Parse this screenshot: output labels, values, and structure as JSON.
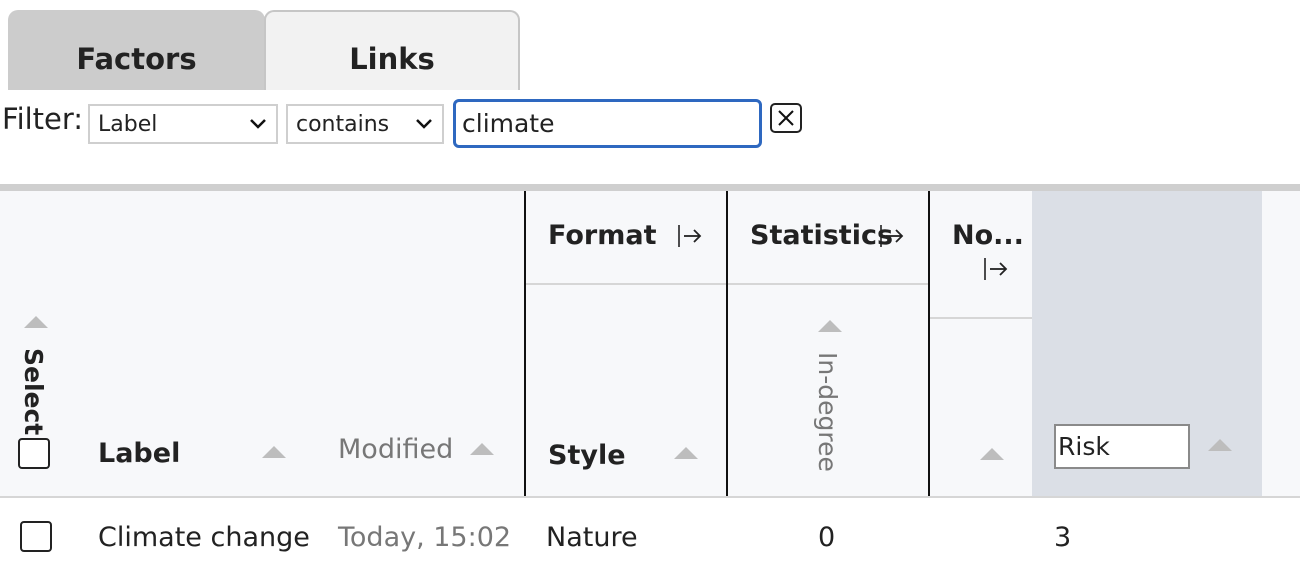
{
  "tabs": [
    {
      "label": "Factors",
      "active": true
    },
    {
      "label": "Links",
      "active": false
    }
  ],
  "filter": {
    "label": "Filter:",
    "field": "Label",
    "operator": "contains",
    "value": "climate"
  },
  "table": {
    "groups": {
      "format": "Format",
      "statistics": "Statistics",
      "notes": "No..."
    },
    "columns": {
      "select": "Select",
      "label": "Label",
      "modified": "Modified",
      "style": "Style",
      "in_degree": "In-degree",
      "risk": "Risk"
    },
    "rows": [
      {
        "label": "Climate change",
        "modified": "Today, 15:02",
        "style": "Nature",
        "in_degree": "0",
        "risk": "3"
      }
    ]
  },
  "colors": {
    "accent": "#2e68c0",
    "tab_active": "#cccccc",
    "risk_column": "#dbdfe6"
  }
}
